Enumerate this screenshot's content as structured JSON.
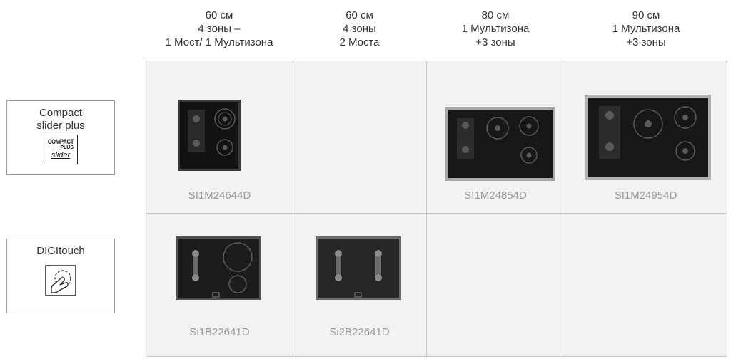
{
  "columns": [
    {
      "lines": [
        "60 см",
        "4 зоны –",
        "1 Мост/ 1 Мультизона"
      ]
    },
    {
      "lines": [
        "60 см",
        "4 зоны",
        "2 Моста"
      ]
    },
    {
      "lines": [
        "80 см",
        "1 Мультизона",
        "+3 зоны"
      ]
    },
    {
      "lines": [
        "90 см",
        "1 Мультизона",
        "+3 зоны"
      ]
    }
  ],
  "rows": [
    {
      "label_lines": [
        "Compact",
        "slider plus"
      ],
      "logo_lines": [
        "COMPACT",
        "PLUS",
        "slider"
      ],
      "icon": "compact-slider-plus-logo"
    },
    {
      "label_lines": [
        "DIGItouch"
      ],
      "icon": "digitouch-icon"
    }
  ],
  "products": {
    "r1c1": "SI1M24644D",
    "r1c3": "SI1M24854D",
    "r1c4": "SI1M24954D",
    "r2c1": "Si1B22641D",
    "r2c2": "Si2B22641D"
  }
}
